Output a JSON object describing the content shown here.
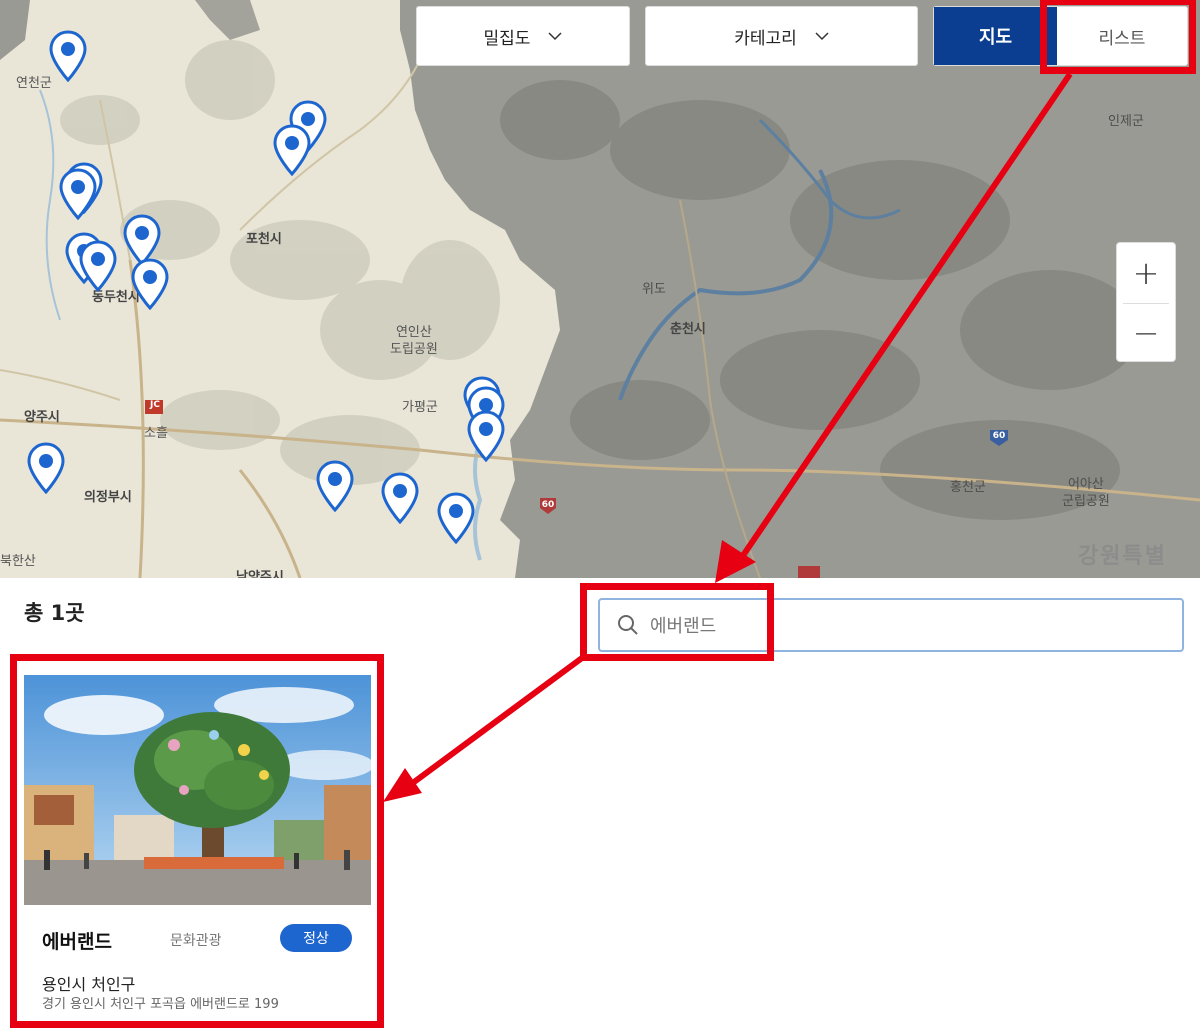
{
  "map": {
    "places": [
      {
        "name": "연천군"
      },
      {
        "name": "포천시"
      },
      {
        "name": "동두천시"
      },
      {
        "name": "양주시"
      },
      {
        "name": "의정부시"
      },
      {
        "name": "남양주시"
      },
      {
        "name": "소흘"
      },
      {
        "name": "연인산\n도립공원"
      },
      {
        "name": "가평군"
      },
      {
        "name": "춘천시"
      },
      {
        "name": "위도"
      },
      {
        "name": "인제군"
      },
      {
        "name": "홍천군"
      },
      {
        "name": "어아산\n군립공원"
      },
      {
        "name": "강원특별"
      },
      {
        "name": "북한산"
      },
      {
        "name": "JC"
      },
      {
        "name": "60"
      },
      {
        "name": "60"
      }
    ],
    "pin_count": 16,
    "pin_color": "#1e66cf",
    "controls": {
      "density_label": "밀집도",
      "category_label": "카테고리",
      "view_map_label": "지도",
      "view_list_label": "리스트",
      "zoom_in": "+",
      "zoom_out": "−"
    }
  },
  "results": {
    "count_label": "총 1곳"
  },
  "search": {
    "value": "에버랜드",
    "icon": "search-icon"
  },
  "card": {
    "name": "에버랜드",
    "category": "문화관광",
    "status": "정상",
    "region": "용인시 처인구",
    "address": "경기 용인시 처인구 포곡읍 에버랜드로 199",
    "status_color": "#1e66cf"
  },
  "annotation": {
    "highlight_color": "#e60012"
  }
}
